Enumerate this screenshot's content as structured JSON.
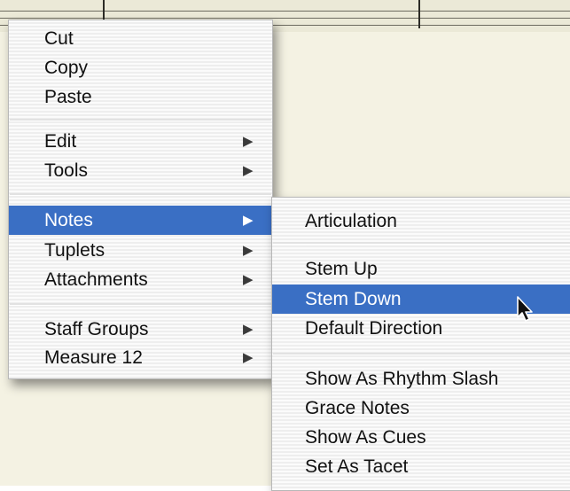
{
  "window": {
    "background": "#f4f2e3"
  },
  "context_menu": {
    "items": [
      {
        "label": "Cut",
        "submenu": false
      },
      {
        "label": "Copy",
        "submenu": false
      },
      {
        "label": "Paste",
        "submenu": false
      },
      {
        "label": "Edit",
        "submenu": true
      },
      {
        "label": "Tools",
        "submenu": true
      },
      {
        "label": "Notes",
        "submenu": true,
        "selected": true
      },
      {
        "label": "Tuplets",
        "submenu": true
      },
      {
        "label": "Attachments",
        "submenu": true
      },
      {
        "label": "Staff Groups",
        "submenu": true
      },
      {
        "label": "Measure 12",
        "submenu": true
      }
    ],
    "submenu_arrow": "▶"
  },
  "notes_submenu": {
    "items": [
      {
        "label": "Articulation",
        "submenu": true
      },
      {
        "label": "Stem Up"
      },
      {
        "label": "Stem Down",
        "selected": true
      },
      {
        "label": "Default Direction"
      },
      {
        "label": "Show As Rhythm Slash"
      },
      {
        "label": "Grace Notes"
      },
      {
        "label": "Show As Cues"
      },
      {
        "label": "Set As Tacet"
      }
    ]
  },
  "cursor": {
    "icon": "arrow-pointer-icon"
  },
  "colors": {
    "selection": "#3a6fc4",
    "menu_background": "#f6f6f6",
    "menu_text": "#111111"
  }
}
